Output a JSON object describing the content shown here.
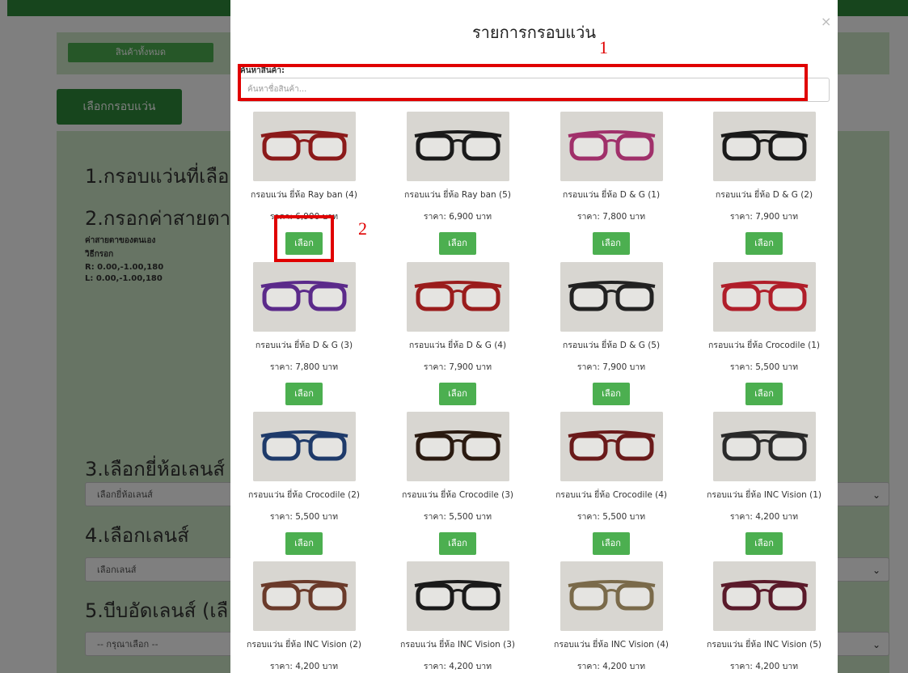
{
  "background": {
    "all_products": "สินค้าทั้งหมด",
    "select_frame": "เลือกกรอบแว่น",
    "step1": "1.กรอบแว่นที่เลือ",
    "step2": "2.กรอกค่าสายตา",
    "own_prescription": "ค่าสายตาของตนเอง",
    "method": "วิธีกรอก",
    "right_eye": "R: 0.00,-1.00,180",
    "left_eye": "L: 0.00,-1.00,180",
    "step3": "3.เลือกยี่ห้อเลนส์",
    "lens_brand_select": "เลือกยี่ห้อเลนส์",
    "step4": "4.เลือกเลนส์",
    "lens_select": "เลือกเลนส์",
    "step5": "5.บีบอัดเลนส์ (เลื",
    "compress_select": "-- กรุณาเลือก --",
    "chevron": "⌄"
  },
  "modal": {
    "title": "รายการกรอบแว่น",
    "close": "×",
    "search_label": "ค้นหาสินค้า:",
    "search_placeholder": "ค้นหาชื่อสินค้า..."
  },
  "products": [
    {
      "name": "กรอบแว่น ยี่ห้อ Ray ban (4)",
      "price": "ราคา: 6,900 บาท",
      "button": "เลือก",
      "frame_color": "#8b1a1a"
    },
    {
      "name": "กรอบแว่น ยี่ห้อ Ray ban (5)",
      "price": "ราคา: 6,900 บาท",
      "button": "เลือก",
      "frame_color": "#1a1a1a"
    },
    {
      "name": "กรอบแว่น ยี่ห้อ D & G (1)",
      "price": "ราคา: 7,800 บาท",
      "button": "เลือก",
      "frame_color": "#a0306a"
    },
    {
      "name": "กรอบแว่น ยี่ห้อ D & G (2)",
      "price": "ราคา: 7,900 บาท",
      "button": "เลือก",
      "frame_color": "#1a1a1a"
    },
    {
      "name": "กรอบแว่น ยี่ห้อ D & G (3)",
      "price": "ราคา: 7,800 บาท",
      "button": "เลือก",
      "frame_color": "#5b2a8a"
    },
    {
      "name": "กรอบแว่น ยี่ห้อ D & G (4)",
      "price": "ราคา: 7,900 บาท",
      "button": "เลือก",
      "frame_color": "#9a1c1c"
    },
    {
      "name": "กรอบแว่น ยี่ห้อ D & G (5)",
      "price": "ราคา: 7,900 บาท",
      "button": "เลือก",
      "frame_color": "#222222"
    },
    {
      "name": "กรอบแว่น ยี่ห้อ Crocodile (1)",
      "price": "ราคา: 5,500 บาท",
      "button": "เลือก",
      "frame_color": "#b01e2a"
    },
    {
      "name": "กรอบแว่น ยี่ห้อ Crocodile (2)",
      "price": "ราคา: 5,500 บาท",
      "button": "เลือก",
      "frame_color": "#1e3a6a"
    },
    {
      "name": "กรอบแว่น ยี่ห้อ Crocodile (3)",
      "price": "ราคา: 5,500 บาท",
      "button": "เลือก",
      "frame_color": "#2a1a10"
    },
    {
      "name": "กรอบแว่น ยี่ห้อ Crocodile (4)",
      "price": "ราคา: 5,500 บาท",
      "button": "เลือก",
      "frame_color": "#6a1a1a"
    },
    {
      "name": "กรอบแว่น ยี่ห้อ INC Vision (1)",
      "price": "ราคา: 4,200 บาท",
      "button": "เลือก",
      "frame_color": "#2a2a2a"
    },
    {
      "name": "กรอบแว่น ยี่ห้อ INC Vision (2)",
      "price": "ราคา: 4,200 บาท",
      "button": "เลือก",
      "frame_color": "#6a3a2a"
    },
    {
      "name": "กรอบแว่น ยี่ห้อ INC Vision (3)",
      "price": "ราคา: 4,200 บาท",
      "button": "เลือก",
      "frame_color": "#1a1a1a"
    },
    {
      "name": "กรอบแว่น ยี่ห้อ INC Vision (4)",
      "price": "ราคา: 4,200 บาท",
      "button": "เลือก",
      "frame_color": "#7a6a4a"
    },
    {
      "name": "กรอบแว่น ยี่ห้อ INC Vision (5)",
      "price": "ราคา: 4,200 บาท",
      "button": "เลือก",
      "frame_color": "#5a1a2a"
    }
  ],
  "annotations": {
    "label1": "1",
    "label2": "2",
    "color": "#e00000"
  }
}
